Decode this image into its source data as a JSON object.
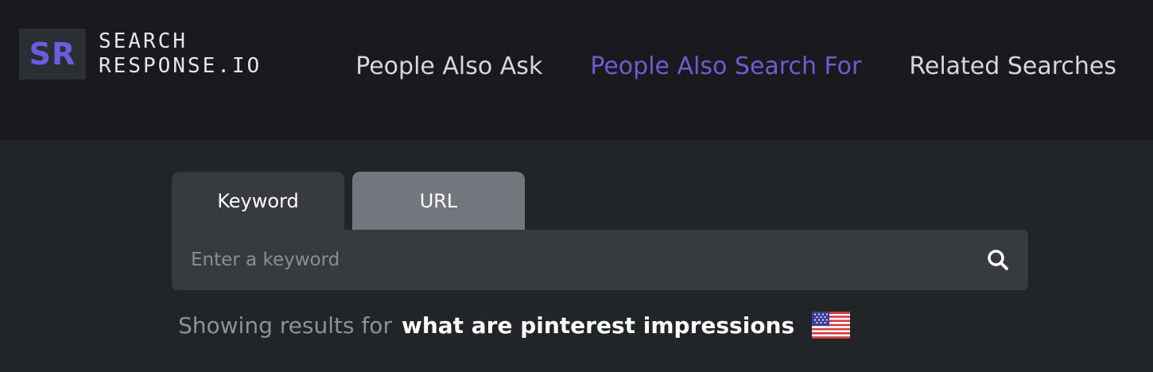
{
  "logo": {
    "mark": "SR",
    "line1": "SEARCH",
    "line2": "RESPONSE.IO"
  },
  "nav": {
    "items": [
      {
        "label": "People Also Ask",
        "active": false
      },
      {
        "label": "People Also Search For",
        "active": true
      },
      {
        "label": "Related Searches",
        "active": false
      }
    ]
  },
  "tabs": [
    {
      "label": "Keyword",
      "active": true
    },
    {
      "label": "URL",
      "active": false
    }
  ],
  "search": {
    "placeholder": "Enter a keyword",
    "value": "",
    "button_icon": "search-icon"
  },
  "results": {
    "prefix": "Showing results for",
    "query": "what are pinterest impressions",
    "flag_icon": "us-flag-icon"
  },
  "colors": {
    "accent": "#6c5dd3",
    "header_bg": "#181a1d",
    "body_bg": "#222528",
    "active_tab": "#373b40",
    "inactive_tab": "#73767c"
  }
}
